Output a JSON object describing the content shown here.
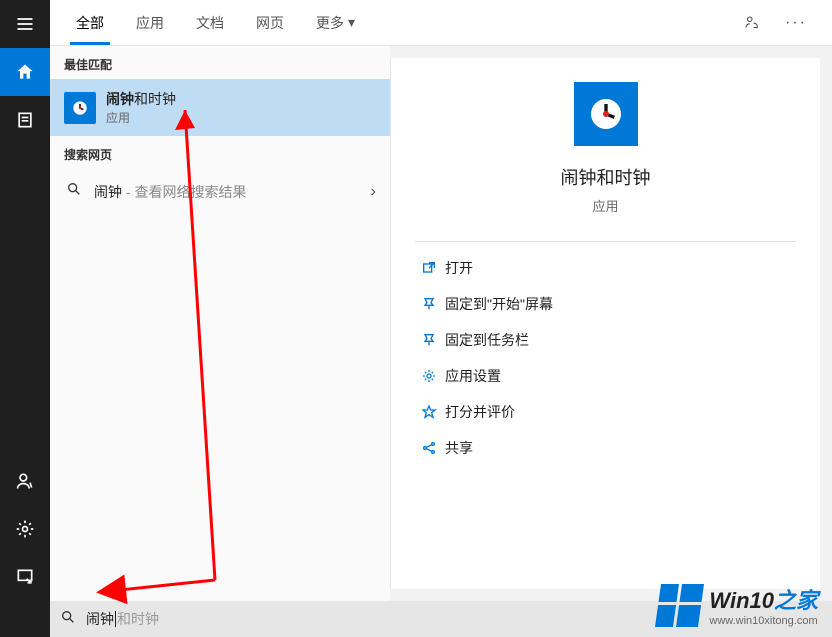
{
  "sidebar": {
    "top": [
      "menu",
      "home",
      "recent"
    ],
    "bottom": [
      "user",
      "settings",
      "power"
    ]
  },
  "tabs": {
    "items": [
      {
        "label": "全部",
        "active": true
      },
      {
        "label": "应用"
      },
      {
        "label": "文档"
      },
      {
        "label": "网页"
      },
      {
        "label": "更多",
        "dropdown": true
      }
    ]
  },
  "results": {
    "best_match_header": "最佳匹配",
    "best_match": {
      "title_bold": "闹钟",
      "title_rest": "和时钟",
      "subtitle": "应用"
    },
    "web_header": "搜索网页",
    "web_item": {
      "query": "闹钟",
      "suffix": " - 查看网络搜索结果"
    }
  },
  "detail": {
    "title": "闹钟和时钟",
    "subtitle": "应用",
    "actions": [
      {
        "icon": "open",
        "label": "打开"
      },
      {
        "icon": "pin-start",
        "label": "固定到\"开始\"屏幕"
      },
      {
        "icon": "pin-taskbar",
        "label": "固定到任务栏"
      },
      {
        "icon": "settings",
        "label": "应用设置"
      },
      {
        "icon": "rate",
        "label": "打分并评价"
      },
      {
        "icon": "share",
        "label": "共享"
      }
    ]
  },
  "search": {
    "typed": "闹钟",
    "hint_rest": "和时钟"
  },
  "watermark": {
    "brand_a": "Win10",
    "brand_b": "之家",
    "url": "www.win10xitong.com"
  }
}
